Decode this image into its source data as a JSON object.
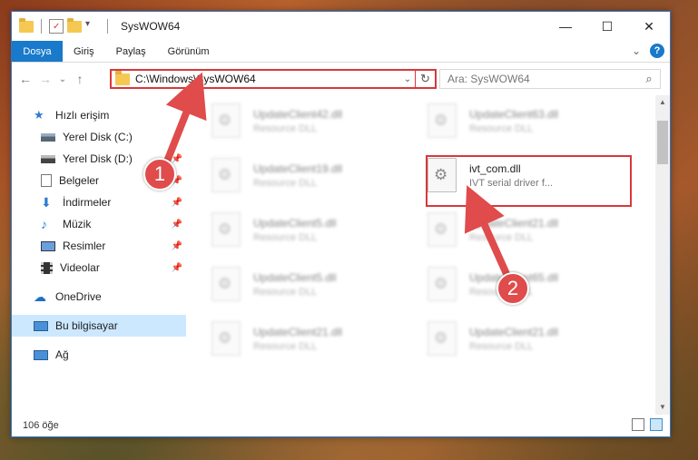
{
  "window": {
    "title": "SysWOW64",
    "controls": {
      "minimize": "—",
      "maximize": "☐",
      "close": "✕"
    }
  },
  "ribbon": {
    "tabs": [
      "Dosya",
      "Giriş",
      "Paylaş",
      "Görünüm"
    ],
    "expand_glyph": "⌄",
    "help": "?"
  },
  "nav": {
    "back": "←",
    "forward": "→",
    "recent": "⌄",
    "up": "↑"
  },
  "address": {
    "path": "C:\\Windows\\SysWOW64",
    "dropdown": "⌄",
    "refresh": "↻"
  },
  "search": {
    "placeholder": "Ara: SysWOW64",
    "icon": "⌕"
  },
  "sidebar": {
    "items": [
      {
        "label": "Hızlı erişim",
        "icon": "star-icon"
      },
      {
        "label": "Yerel Disk (C:)",
        "icon": "drive-icon"
      },
      {
        "label": "Yerel Disk (D:)",
        "icon": "drive-icon"
      },
      {
        "label": "Belgeler",
        "icon": "documents-icon"
      },
      {
        "label": "İndirmeler",
        "icon": "download-icon"
      },
      {
        "label": "Müzik",
        "icon": "music-icon"
      },
      {
        "label": "Resimler",
        "icon": "pictures-icon"
      },
      {
        "label": "Videolar",
        "icon": "video-icon"
      },
      {
        "label": "OneDrive",
        "icon": "cloud-icon"
      },
      {
        "label": "Bu bilgisayar",
        "icon": "computer-icon"
      },
      {
        "label": "Ağ",
        "icon": "network-icon"
      }
    ]
  },
  "files": [
    {
      "name": "UpdateClient42.dll",
      "desc": "Resource DLL"
    },
    {
      "name": "UpdateClient63.dll",
      "desc": "Resource DLL"
    },
    {
      "name": "UpdateClient19.dll",
      "desc": "Resource DLL"
    },
    {
      "name": "ivt_com.dll",
      "desc": "IVT serial driver f..."
    },
    {
      "name": "UpdateClient5.dll",
      "desc": "Resource DLL"
    },
    {
      "name": "UpdateClient21.dll",
      "desc": "Resource DLL"
    },
    {
      "name": "UpdateClient5.dll",
      "desc": "Resource DLL"
    },
    {
      "name": "UpdateClient65.dll",
      "desc": "Resource DLL"
    },
    {
      "name": "UpdateClient21.dll",
      "desc": "Resource DLL"
    },
    {
      "name": "UpdateClient21.dll",
      "desc": "Resource DLL"
    }
  ],
  "statusbar": {
    "count": "106 öğe"
  },
  "annotations": {
    "step1": "1",
    "step2": "2",
    "accent": "#d9383a"
  }
}
